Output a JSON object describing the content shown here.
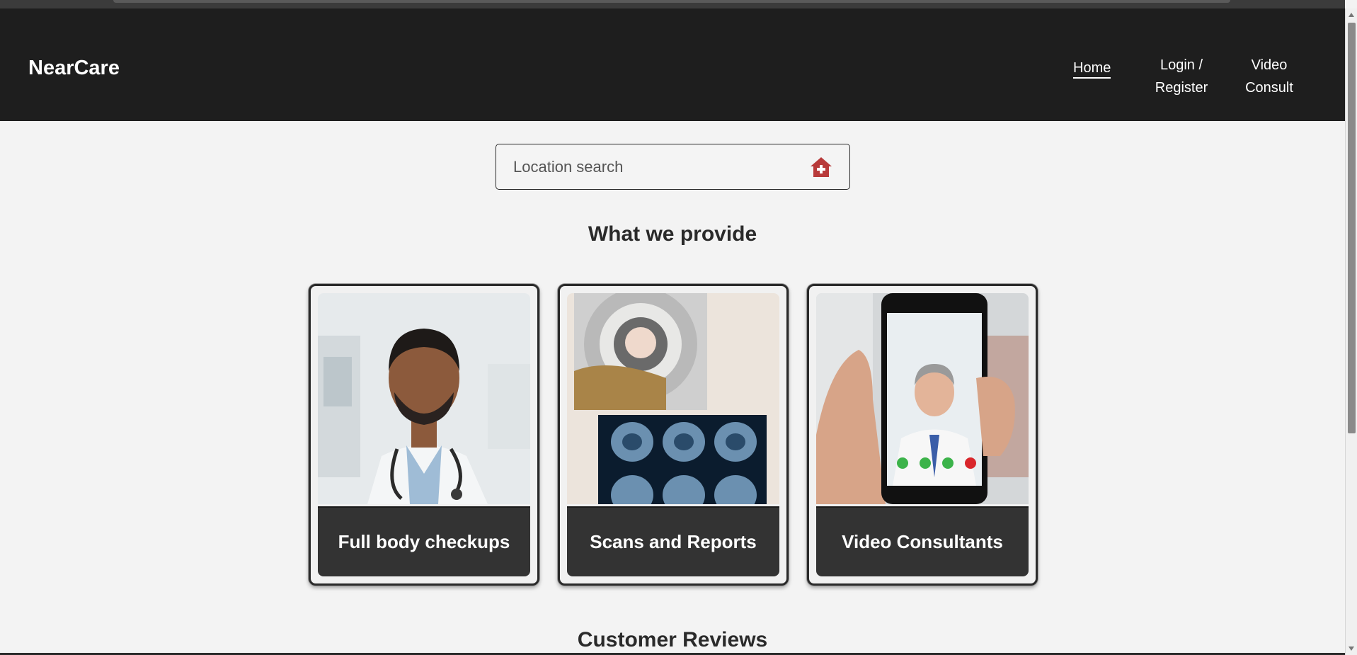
{
  "brand": "NearCare",
  "nav": {
    "home": "Home",
    "login_line1": "Login /",
    "login_line2": "Register",
    "video_line1": "Video",
    "video_line2": "Consult"
  },
  "search": {
    "placeholder": "Location search",
    "icon": "hospital-house-icon"
  },
  "sections": {
    "provide_title": "What we provide",
    "reviews_title": "Customer Reviews"
  },
  "cards": [
    {
      "label": "Full body checkups",
      "image": "doctor-portrait-image"
    },
    {
      "label": "Scans and Reports",
      "image": "mri-scan-image"
    },
    {
      "label": "Video Consultants",
      "image": "phone-video-call-image"
    }
  ],
  "colors": {
    "header_bg": "#1e1e1e",
    "page_bg": "#f3f3f3",
    "card_label_bg": "#333333",
    "icon_accent": "#b83a3a"
  }
}
